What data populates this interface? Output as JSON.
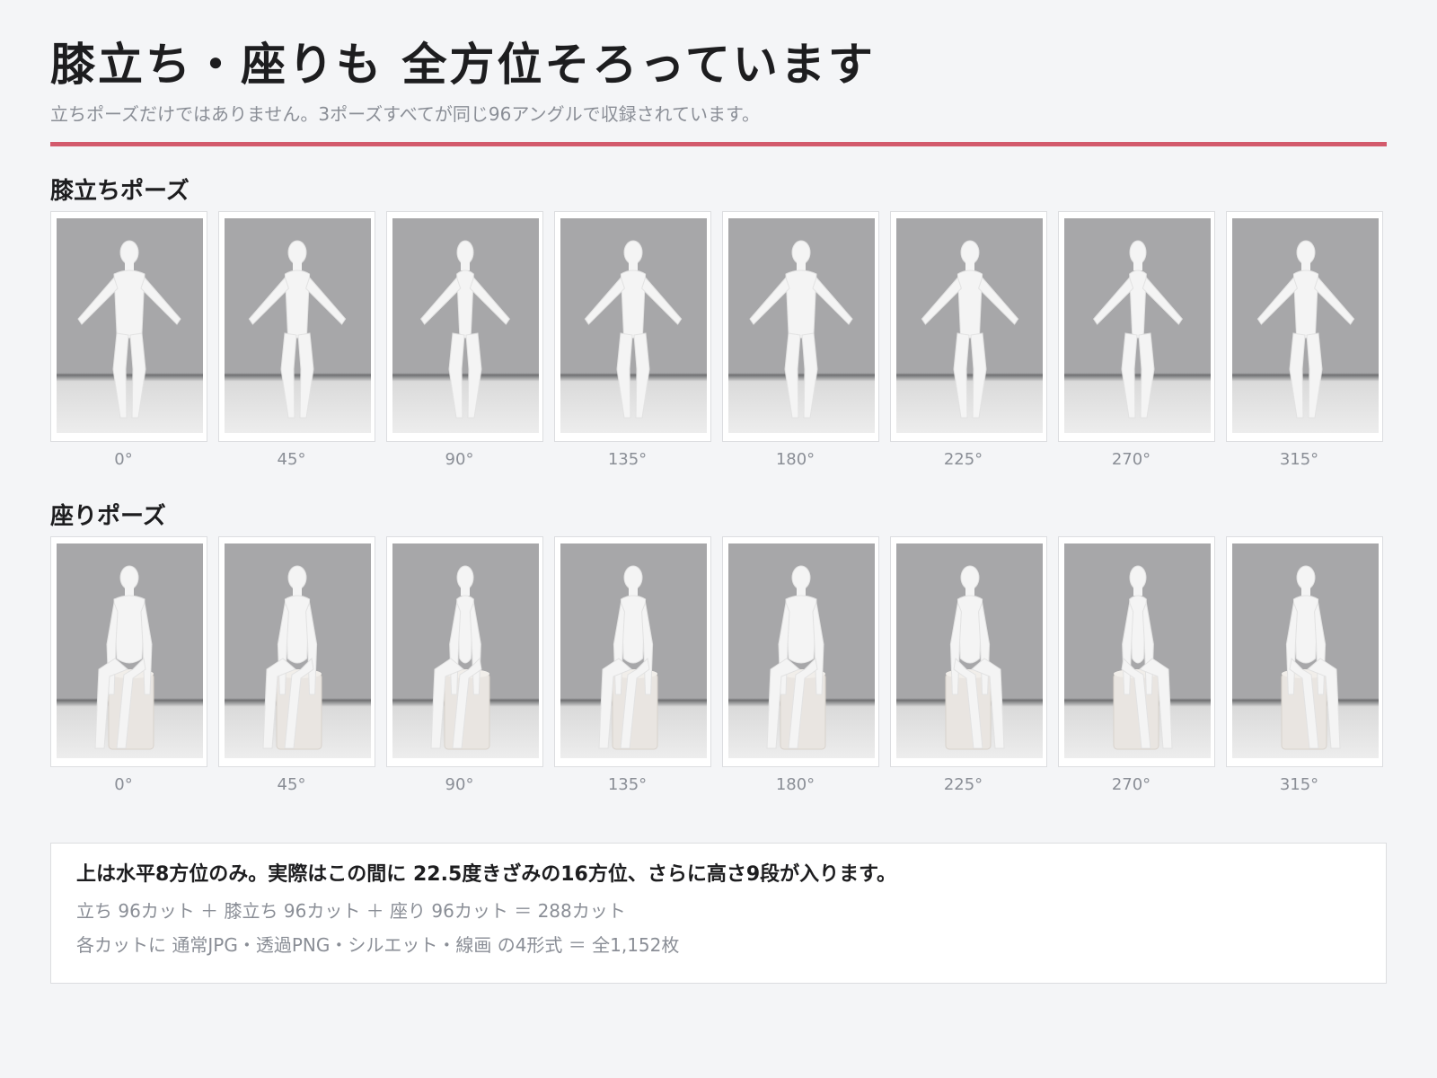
{
  "header": {
    "title": "膝立ち・座りも 全方位そろっています",
    "subtitle": "立ちポーズだけではありません。3ポーズすべてが同じ96アングルで収録されています。",
    "accent_color": "#d35a6c"
  },
  "sections": [
    {
      "title": "膝立ちポーズ",
      "pose": "kneeling",
      "angles": [
        "0°",
        "45°",
        "90°",
        "135°",
        "180°",
        "225°",
        "270°",
        "315°"
      ]
    },
    {
      "title": "座りポーズ",
      "pose": "sitting",
      "angles": [
        "0°",
        "45°",
        "90°",
        "135°",
        "180°",
        "225°",
        "270°",
        "315°"
      ]
    }
  ],
  "note": {
    "headline": "上は水平8方位のみ。実際はこの間に 22.5度きざみの16方位、さらに高さ9段が入ります。",
    "line1": "立ち 96カット ＋ 膝立ち 96カット ＋ 座り 96カット ＝ 288カット",
    "line2": "各カットに 通常JPG・透過PNG・シルエット・線画 の4形式 ＝ 全1,152枚"
  }
}
